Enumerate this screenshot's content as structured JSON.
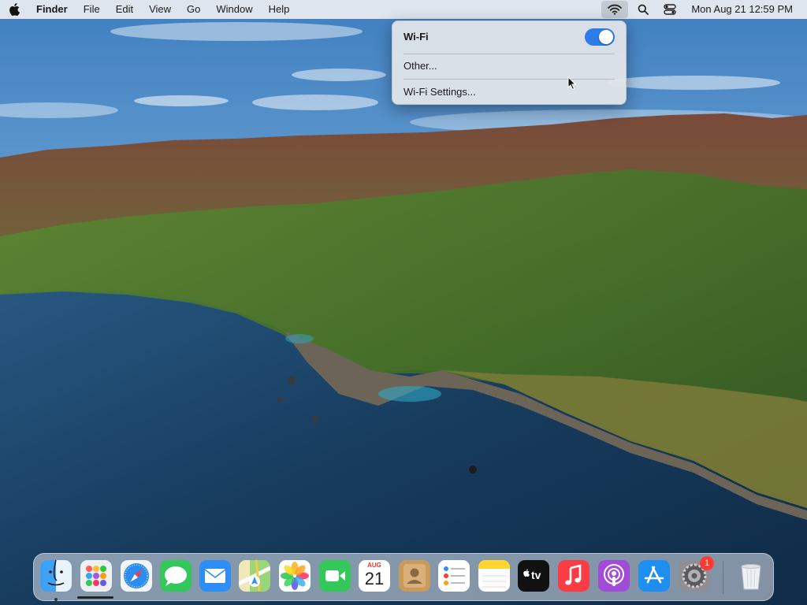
{
  "menubar": {
    "app_name": "Finder",
    "items": [
      "File",
      "Edit",
      "View",
      "Go",
      "Window",
      "Help"
    ],
    "clock": "Mon Aug 21  12:59 PM",
    "icons": [
      "wifi-icon",
      "search-icon",
      "control-center-icon"
    ]
  },
  "wifi_menu": {
    "title": "Wi-Fi",
    "enabled": true,
    "other_label": "Other...",
    "settings_label": "Wi-Fi Settings..."
  },
  "dock": {
    "apps": [
      "finder",
      "launchpad",
      "safari",
      "messages",
      "mail",
      "maps",
      "photos",
      "facetime",
      "calendar",
      "contacts",
      "reminders",
      "notes",
      "apple-tv",
      "music",
      "podcasts",
      "app-store",
      "system-settings",
      "trash"
    ],
    "calendar_month": "AUG",
    "calendar_day": "21",
    "tv_label": "tv",
    "settings_badge": "1"
  },
  "colors": {
    "accent": "#2f7ce8",
    "badge": "#ff3b30"
  }
}
